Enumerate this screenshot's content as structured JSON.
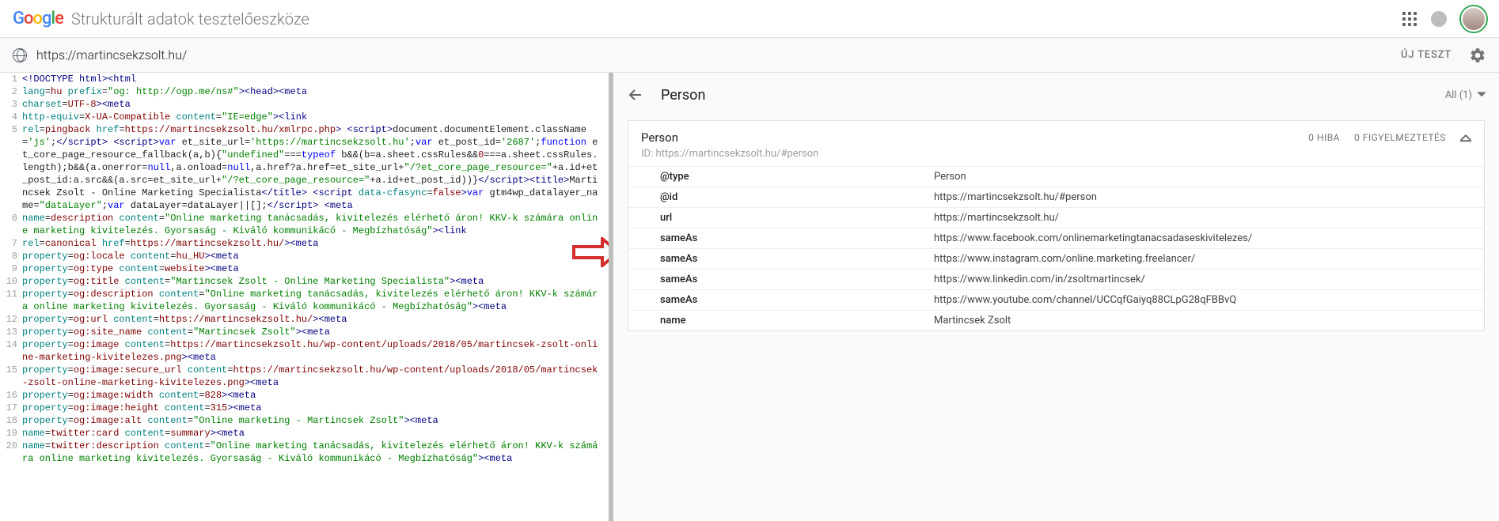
{
  "header": {
    "appTitle": "Strukturált adatok tesztelőeszköze"
  },
  "urlbar": {
    "url": "https://martincsekzsolt.hu/",
    "newTest": "ÚJ TESZT"
  },
  "code": [
    {
      "n": 1,
      "h": "<span class='c-tag'>&lt;!DOCTYPE html&gt;</span><span class='c-tag'>&lt;html</span>"
    },
    {
      "n": 2,
      "h": "<span class='c-attr'>lang</span>=<span class='c-id'>hu</span> <span class='c-attr'>prefix</span>=<span class='c-str'>\"og: http://ogp.me/ns#\"</span><span class='c-tag'>&gt;</span><span class='c-tag'>&lt;head&gt;&lt;meta</span>"
    },
    {
      "n": 3,
      "h": "<span class='c-attr'>charset</span>=<span class='c-id'>UTF-8</span><span class='c-tag'>&gt;&lt;meta</span>"
    },
    {
      "n": 4,
      "h": "<span class='c-attr'>http-equiv</span>=<span class='c-id'>X-UA-Compatible</span> <span class='c-attr'>content</span>=<span class='c-str'>\"IE=edge\"</span><span class='c-tag'>&gt;&lt;link</span>"
    },
    {
      "n": 5,
      "h": "<span class='c-attr'>rel</span>=<span class='c-id'>pingback</span> <span class='c-attr'>href</span>=<span class='c-id'>https://martincsekzsolt.hu/xmlrpc.php</span><span class='c-tag'>&gt;</span> <span class='c-tag'>&lt;script&gt;</span>document.documentElement.className=<span class='c-str'>'js'</span>;<span class='c-tag'>&lt;/script&gt;</span> <span class='c-tag'>&lt;script&gt;</span><span class='c-key'>var</span> et_site_url=<span class='c-str'>'https://martincsekzsolt.hu'</span>;<span class='c-key'>var</span> et_post_id=<span class='c-str'>'2687'</span>;<span class='c-key'>function</span> et_core_page_resource_fallback(a,b){<span class='c-str'>\"undefined\"</span>===<span class='c-key'>typeof</span> b&amp;&amp;(b=a.sheet.cssRules&amp;&amp;<span class='c-id'>0</span>===a.sheet.cssRules.length);b&amp;&amp;(a.onerror=<span class='c-key'>null</span>,a.onload=<span class='c-key'>null</span>,a.href?a.href=et_site_url+<span class='c-str'>\"/?et_core_page_resource=\"</span>+a.id+et_post_id:a.src&amp;&amp;(a.src=et_site_url+<span class='c-str'>\"/?et_core_page_resource=\"</span>+a.id+et_post_id))}<span class='c-tag'>&lt;/script&gt;</span><span class='c-tag'>&lt;title&gt;</span>Martincsek Zsolt - Online Marketing Specialista<span class='c-tag'>&lt;/title&gt;</span> <span class='c-tag'>&lt;script</span> <span class='c-attr'>data-cfasync</span>=<span class='c-id'>false</span><span class='c-tag'>&gt;</span><span class='c-key'>var</span> gtm4wp_datalayer_name=<span class='c-str'>\"dataLayer\"</span>;<span class='c-key'>var</span> dataLayer=dataLayer||[];<span class='c-tag'>&lt;/script&gt;</span> <span class='c-tag'>&lt;meta</span>"
    },
    {
      "n": 6,
      "h": "<span class='c-attr'>name</span>=<span class='c-id'>description</span> <span class='c-attr'>content</span>=<span class='c-str'>\"Online marketing tanácsadás, kivitelezés elérhető áron! KKV-k számára online marketing kivitelezés. Gyorsaság - Kiváló kommunikácó - Megbízhatóság\"</span><span class='c-tag'>&gt;&lt;link</span>"
    },
    {
      "n": 7,
      "h": "<span class='c-attr'>rel</span>=<span class='c-id'>canonical</span> <span class='c-attr'>href</span>=<span class='c-id'>https://martincsekzsolt.hu/</span><span class='c-tag'>&gt;&lt;meta</span>"
    },
    {
      "n": 8,
      "h": "<span class='c-attr'>property</span>=<span class='c-id'>og:locale</span> <span class='c-attr'>content</span>=<span class='c-id'>hu_HU</span><span class='c-tag'>&gt;&lt;meta</span>"
    },
    {
      "n": 9,
      "h": "<span class='c-attr'>property</span>=<span class='c-id'>og:type</span> <span class='c-attr'>content</span>=<span class='c-id'>website</span><span class='c-tag'>&gt;&lt;meta</span>"
    },
    {
      "n": 10,
      "h": "<span class='c-attr'>property</span>=<span class='c-id'>og:title</span> <span class='c-attr'>content</span>=<span class='c-str'>\"Martincsek Zsolt - Online Marketing Specialista\"</span><span class='c-tag'>&gt;&lt;meta</span>"
    },
    {
      "n": 11,
      "h": "<span class='c-attr'>property</span>=<span class='c-id'>og:description</span> <span class='c-attr'>content</span>=<span class='c-str'>\"Online marketing tanácsadás, kivitelezés elérhető áron! KKV-k számára online marketing kivitelezés. Gyorsaság - Kiváló kommunikácó - Megbízhatóság\"</span><span class='c-tag'>&gt;&lt;meta</span>"
    },
    {
      "n": 12,
      "h": "<span class='c-attr'>property</span>=<span class='c-id'>og:url</span> <span class='c-attr'>content</span>=<span class='c-id'>https://martincsekzsolt.hu/</span><span class='c-tag'>&gt;&lt;meta</span>"
    },
    {
      "n": 13,
      "h": "<span class='c-attr'>property</span>=<span class='c-id'>og:site_name</span> <span class='c-attr'>content</span>=<span class='c-str'>\"Martincsek Zsolt\"</span><span class='c-tag'>&gt;&lt;meta</span>"
    },
    {
      "n": 14,
      "h": "<span class='c-attr'>property</span>=<span class='c-id'>og:image</span> <span class='c-attr'>content</span>=<span class='c-id'>https://martincsekzsolt.hu/wp-content/uploads/2018/05/martincsek-zsolt-online-marketing-kivitelezes.png</span><span class='c-tag'>&gt;&lt;meta</span>"
    },
    {
      "n": 15,
      "h": "<span class='c-attr'>property</span>=<span class='c-id'>og:image:secure_url</span> <span class='c-attr'>content</span>=<span class='c-id'>https://martincsekzsolt.hu/wp-content/uploads/2018/05/martincsek-zsolt-online-marketing-kivitelezes.png</span><span class='c-tag'>&gt;&lt;meta</span>"
    },
    {
      "n": 16,
      "h": "<span class='c-attr'>property</span>=<span class='c-id'>og:image:width</span> <span class='c-attr'>content</span>=<span class='c-id'>828</span><span class='c-tag'>&gt;&lt;meta</span>"
    },
    {
      "n": 17,
      "h": "<span class='c-attr'>property</span>=<span class='c-id'>og:image:height</span> <span class='c-attr'>content</span>=<span class='c-id'>315</span><span class='c-tag'>&gt;&lt;meta</span>"
    },
    {
      "n": 18,
      "h": "<span class='c-attr'>property</span>=<span class='c-id'>og:image:alt</span> <span class='c-attr'>content</span>=<span class='c-str'>\"Online marketing - Martincsek Zsolt\"</span><span class='c-tag'>&gt;&lt;meta</span>"
    },
    {
      "n": 19,
      "h": "<span class='c-attr'>name</span>=<span class='c-id'>twitter:card</span> <span class='c-attr'>content</span>=<span class='c-id'>summary</span><span class='c-tag'>&gt;&lt;meta</span>"
    },
    {
      "n": 20,
      "h": "<span class='c-attr'>name</span>=<span class='c-id'>twitter:description</span> <span class='c-attr'>content</span>=<span class='c-str'>\"Online marketing tanácsadás, kivitelezés elérhető áron! KKV-k számára online marketing kivitelezés. Gyorsaság - Kiváló kommunikácó - Megbízhatóság\"</span><span class='c-tag'>&gt;&lt;meta</span>"
    }
  ],
  "results": {
    "title": "Person",
    "filter": "All (1)",
    "card": {
      "title": "Person",
      "errors": "0 HIBA",
      "warnings": "0 FIGYELMEZTETÉS",
      "idLabel": "ID: https://martincsekzsolt.hu/#person",
      "rows": [
        {
          "k": "@type",
          "v": "Person"
        },
        {
          "k": "@id",
          "v": "https://martincsekzsolt.hu/#person"
        },
        {
          "k": "url",
          "v": "https://martincsekzsolt.hu/"
        },
        {
          "k": "sameAs",
          "v": "https://www.facebook.com/onlinemarketingtanacsadaseskivitelezes/"
        },
        {
          "k": "sameAs",
          "v": "https://www.instagram.com/online.marketing.freelancer/"
        },
        {
          "k": "sameAs",
          "v": "https://www.linkedin.com/in/zsoltmartincsek/"
        },
        {
          "k": "sameAs",
          "v": "https://www.youtube.com/channel/UCCqfGaiyq88CLpG28qFBBvQ"
        },
        {
          "k": "name",
          "v": "Martincsek Zsolt"
        }
      ]
    }
  }
}
